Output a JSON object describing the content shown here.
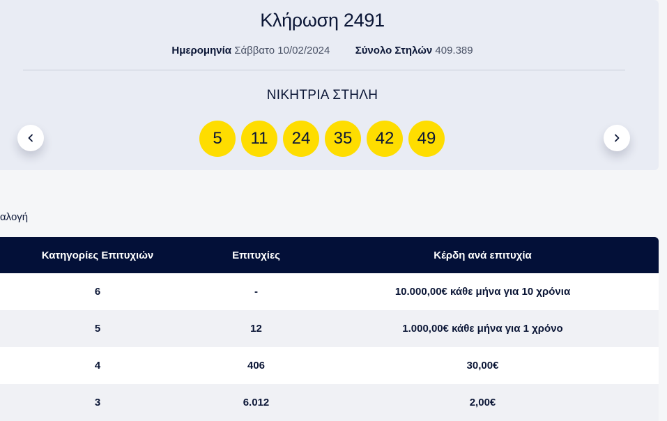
{
  "draw": {
    "title": "Κλήρωση 2491",
    "date_label": "Ημερομηνία",
    "date_value": "Σάββατο 10/02/2024",
    "columns_label": "Σύνολο Στηλών",
    "columns_value": "409.389",
    "winning_label": "ΝΙΚΗΤΡΙΑ ΣΤΗΛΗ",
    "numbers": [
      "5",
      "11",
      "24",
      "35",
      "42",
      "49"
    ],
    "prev_icon": "chevron-left-icon",
    "next_icon": "chevron-right-icon"
  },
  "section": {
    "label": "αλογή"
  },
  "table": {
    "headers": [
      "Κατηγορίες Επιτυχιών",
      "Επιτυχίες",
      "Κέρδη ανά επιτυχία"
    ],
    "rows": [
      [
        "6",
        "-",
        "10.000,00€ κάθε μήνα για 10 χρόνια"
      ],
      [
        "5",
        "12",
        "1.000,00€ κάθε μήνα για 1 χρόνο"
      ],
      [
        "4",
        "406",
        "30,00€"
      ],
      [
        "3",
        "6.012",
        "2,00€"
      ]
    ]
  },
  "colors": {
    "ball": "#fedd00",
    "header_bg": "#031038",
    "card_bg": "#e9ecf4"
  }
}
